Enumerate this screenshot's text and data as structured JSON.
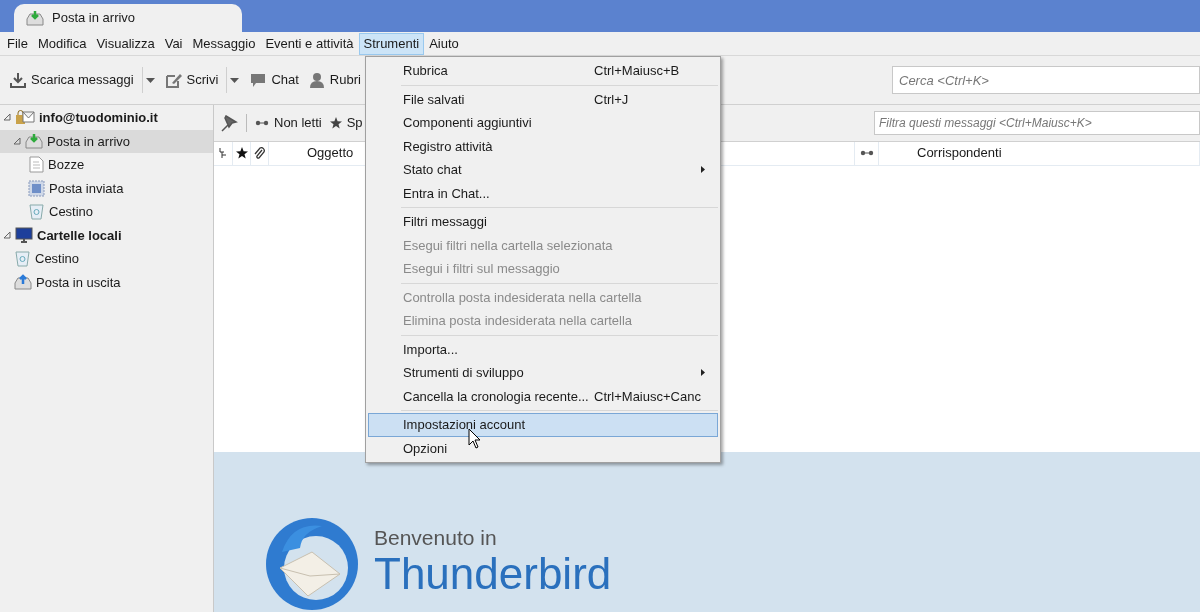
{
  "tab": {
    "title": "Posta in arrivo",
    "selected": true
  },
  "menubar": [
    {
      "label": "File",
      "selected": false
    },
    {
      "label": "Modifica",
      "selected": false
    },
    {
      "label": "Visualizza",
      "selected": false
    },
    {
      "label": "Vai",
      "selected": false
    },
    {
      "label": "Messaggio",
      "selected": false
    },
    {
      "label": "Eventi e attività",
      "selected": false
    },
    {
      "label": "Strumenti",
      "selected": true
    },
    {
      "label": "Aiuto",
      "selected": false
    }
  ],
  "toolbar": [
    {
      "kind": "download",
      "label": "Scarica messaggi",
      "dropdown": true
    },
    {
      "kind": "write",
      "label": "Scrivi",
      "dropdown": true
    },
    {
      "kind": "chat",
      "label": "Chat",
      "dropdown": false
    },
    {
      "kind": "contacts",
      "label": "Rubri",
      "dropdown": false
    }
  ],
  "search": {
    "placeholder": "Cerca <Ctrl+K>"
  },
  "folders": [
    {
      "kind": "account",
      "label": "info@tuodominio.it",
      "expanded": true,
      "selected": false,
      "children": [
        {
          "kind": "inbox",
          "label": "Posta in arrivo",
          "expanded": true,
          "selected": true
        },
        {
          "kind": "drafts",
          "label": "Bozze",
          "selected": false
        },
        {
          "kind": "sent",
          "label": "Posta inviata",
          "selected": false
        },
        {
          "kind": "trash",
          "label": "Cestino",
          "selected": false
        }
      ]
    },
    {
      "kind": "local",
      "label": "Cartelle locali",
      "expanded": true,
      "selected": false,
      "children": [
        {
          "kind": "trash",
          "label": "Cestino",
          "selected": false
        },
        {
          "kind": "outbox",
          "label": "Posta in uscita",
          "selected": false
        }
      ]
    }
  ],
  "filter_bar": {
    "buttons": [
      "Non letti",
      "Sp"
    ],
    "placeholder": "Filtra questi messaggi <Ctrl+Maiusc+K>"
  },
  "columns": [
    {
      "kind": "thread"
    },
    {
      "kind": "star"
    },
    {
      "kind": "attachment"
    },
    {
      "kind": "text",
      "label": "Oggetto"
    },
    {
      "kind": "read"
    },
    {
      "kind": "text",
      "label": "Corrispondenti"
    }
  ],
  "menu": [
    {
      "kind": "item",
      "label": "Rubrica",
      "shortcut": "Ctrl+Maiusc+B",
      "disabled": false,
      "selected": false,
      "submenu": false
    },
    {
      "kind": "separator"
    },
    {
      "kind": "item",
      "label": "File salvati",
      "shortcut": "Ctrl+J",
      "disabled": false,
      "selected": false,
      "submenu": false
    },
    {
      "kind": "item",
      "label": "Componenti aggiuntivi",
      "disabled": false,
      "selected": false,
      "submenu": false
    },
    {
      "kind": "item",
      "label": "Registro attività",
      "disabled": false,
      "selected": false,
      "submenu": false
    },
    {
      "kind": "item",
      "label": "Stato chat",
      "disabled": false,
      "selected": false,
      "submenu": true
    },
    {
      "kind": "item",
      "label": "Entra in Chat...",
      "disabled": false,
      "selected": false,
      "submenu": false
    },
    {
      "kind": "separator"
    },
    {
      "kind": "item",
      "label": "Filtri messaggi",
      "disabled": false,
      "selected": false,
      "submenu": false
    },
    {
      "kind": "item",
      "label": "Esegui filtri nella cartella selezionata",
      "disabled": true,
      "selected": false,
      "submenu": false
    },
    {
      "kind": "item",
      "label": "Esegui i filtri sul messaggio",
      "disabled": true,
      "selected": false,
      "submenu": false
    },
    {
      "kind": "separator"
    },
    {
      "kind": "item",
      "label": "Controlla posta indesiderata nella cartella",
      "disabled": true,
      "selected": false,
      "submenu": false
    },
    {
      "kind": "item",
      "label": "Elimina posta indesiderata nella cartella",
      "disabled": true,
      "selected": false,
      "submenu": false
    },
    {
      "kind": "separator"
    },
    {
      "kind": "item",
      "label": "Importa...",
      "disabled": false,
      "selected": false,
      "submenu": false
    },
    {
      "kind": "item",
      "label": "Strumenti di sviluppo",
      "disabled": false,
      "selected": false,
      "submenu": true
    },
    {
      "kind": "item",
      "label": "Cancella la cronologia recente...",
      "shortcut": "Ctrl+Maiusc+Canc",
      "disabled": false,
      "selected": false,
      "submenu": false
    },
    {
      "kind": "separator"
    },
    {
      "kind": "item",
      "label": "Impostazioni account",
      "disabled": false,
      "selected": true,
      "submenu": false
    },
    {
      "kind": "item",
      "label": "Opzioni",
      "disabled": false,
      "selected": false,
      "submenu": false
    }
  ],
  "welcome": {
    "greeting": "Benvenuto in",
    "product": "Thunderbird"
  }
}
